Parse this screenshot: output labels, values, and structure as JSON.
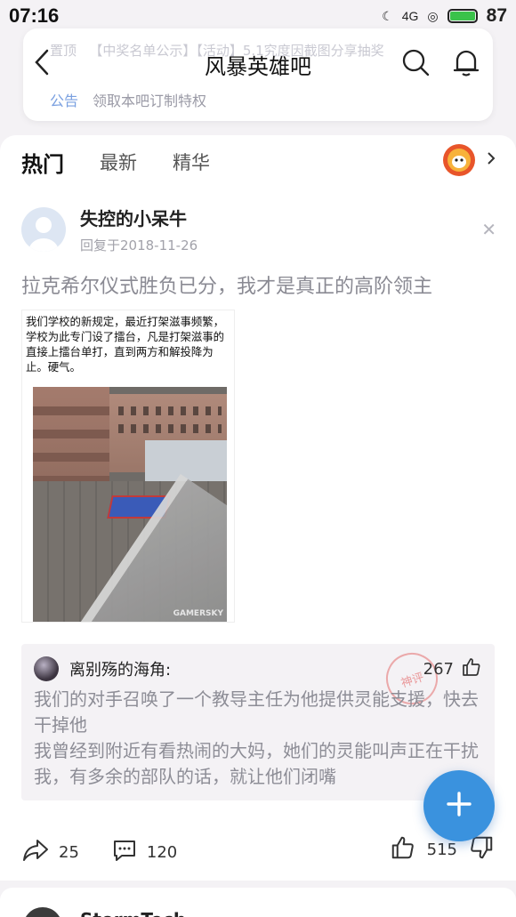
{
  "status_bar": {
    "time": "07:16",
    "network": "4G",
    "battery_percent": "87"
  },
  "header": {
    "ticker_label": "置顶",
    "ticker_text": "【中奖名单公示】【活动】5.1究度因截图分享抽奖",
    "title": "风暴英雄吧",
    "notice_tag": "公告",
    "notice_text": "领取本吧订制特权"
  },
  "tabs": [
    {
      "label": "热门",
      "active": true
    },
    {
      "label": "最新",
      "active": false
    },
    {
      "label": "精华",
      "active": false
    }
  ],
  "post": {
    "author": "失控的小呆牛",
    "reply_date": "回复于2018-11-26",
    "title": "拉克希尔仪式胜负已分，我才是真正的高阶领主",
    "image_caption": "我们学校的新规定，最近打架滋事频繁，学校为此专门设了擂台，凡是打架滋事的直接上擂台单打，直到两方和解投降为止。硬气。",
    "image_watermark": "GAMERSKY",
    "shares": "25",
    "comments": "120",
    "likes": "515"
  },
  "top_comment": {
    "author": "离别殇的海角:",
    "likes": "267",
    "stamp": "神评",
    "line1": "我们的对手召唤了一个教导主任为他提供灵能支援，快去干掉他",
    "line2": "我曾经到附近有看热闹的大妈，她们的灵能叫声正在干扰我，有多余的部队的话，就让他们闭嘴"
  },
  "next_post": {
    "author": "StormTech"
  },
  "colors": {
    "accent": "#3a92de",
    "battery": "#3ac24a",
    "muted_text": "#8d8d96"
  },
  "icons": [
    "back-icon",
    "search-icon",
    "bell-icon",
    "chevron-right-icon",
    "close-icon",
    "share-icon",
    "comment-icon",
    "thumb-up-icon",
    "thumb-down-icon",
    "plus-icon"
  ]
}
